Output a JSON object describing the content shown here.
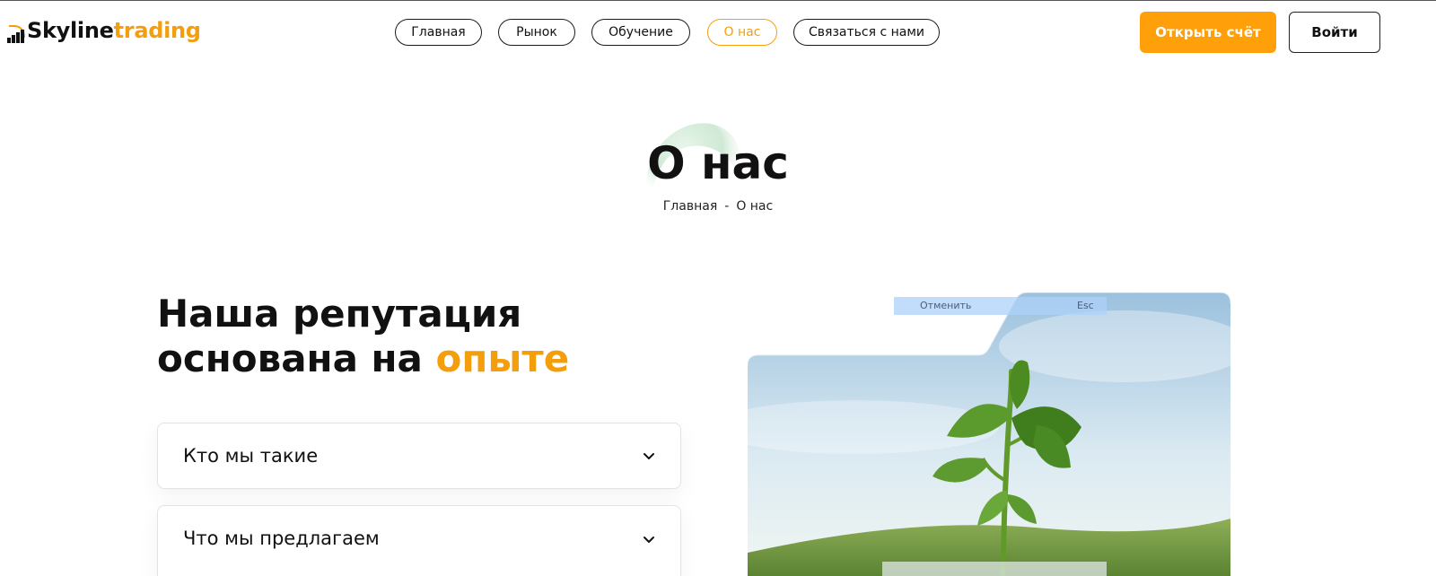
{
  "header": {
    "logo": {
      "part1": "Skyline",
      "part2": "trading"
    },
    "nav": [
      {
        "label": "Главная",
        "active": false
      },
      {
        "label": "Рынок",
        "active": false
      },
      {
        "label": "Обучение",
        "active": false
      },
      {
        "label": "О нас",
        "active": true
      },
      {
        "label": "Связаться с нами",
        "active": false
      }
    ],
    "open_account_label": "Открыть счёт",
    "login_label": "Войти"
  },
  "hero": {
    "title": "О нас",
    "breadcrumb": {
      "home": "Главная",
      "separator": "-",
      "current": "О нас"
    }
  },
  "main": {
    "headline_part1": "Наша репутация основана на",
    "headline_accent": "опыте",
    "faq": [
      {
        "question": "Кто мы такие"
      },
      {
        "question": "Что мы предлагаем"
      }
    ]
  },
  "overlay": {
    "cancel_label": "Отменить",
    "esc_label": "Esc"
  },
  "colors": {
    "accent": "#f59e0b",
    "button": "#ff9f0a",
    "text": "#111111"
  },
  "icons": {
    "faq_toggle": "chevron-down-icon",
    "logo": "bar-chart-logo-icon"
  }
}
